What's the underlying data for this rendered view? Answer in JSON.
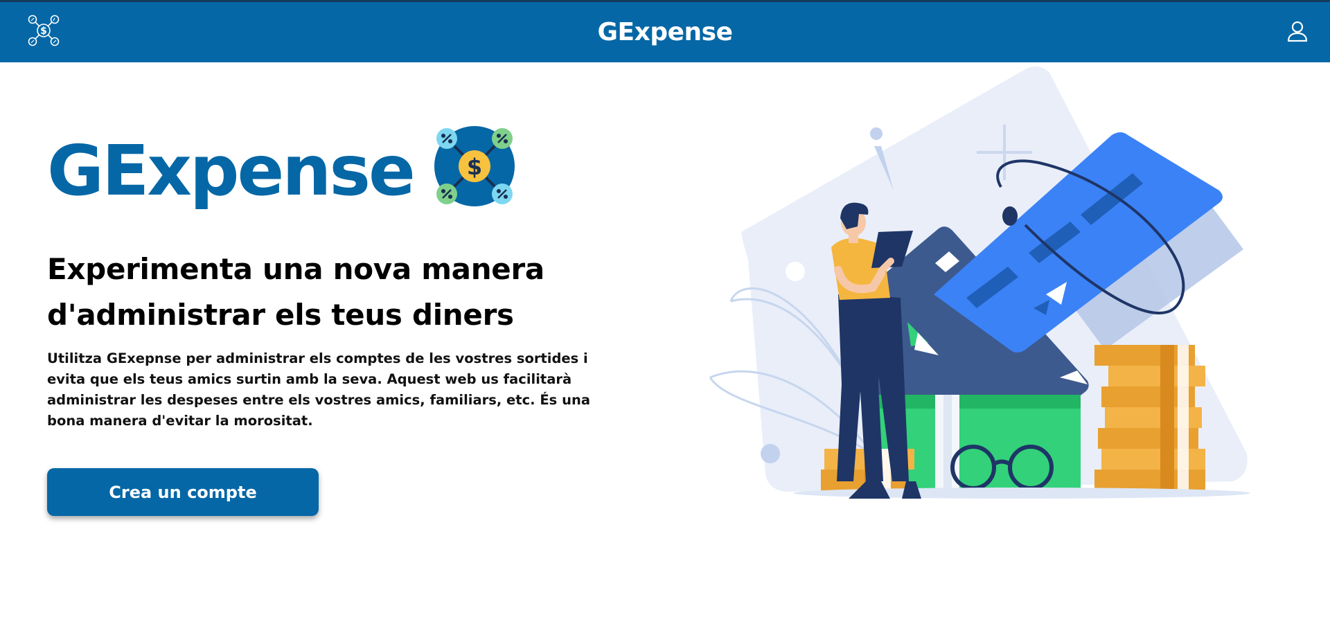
{
  "header": {
    "title": "GExpense",
    "logo_icon": "money-network-icon",
    "user_icon": "user-icon",
    "background_color": "#0567a6"
  },
  "hero": {
    "title": "GExpense",
    "title_color": "#0567a6",
    "logo_icon": "money-network-icon",
    "subtitle": "Experimenta una nova manera d'administrar els teus diners",
    "description": "Utilitza GExepnse per administrar els comptes de les vostres sortides i evita que els teus amics surtin amb la seva. Aquest web us facilitarà administrar les despeses entre els vostres amics, familiars, etc. És una bona manera d'evitar la morositat.",
    "cta_label": "Crea un compte"
  },
  "illustration": {
    "icon": "finance-illustration",
    "colors": {
      "card": "#3b82f6",
      "banknote": "#33d17a",
      "coin": "#f0a733",
      "shirt": "#f5b63f",
      "pants": "#1e3566",
      "background_shape": "#e8eef9"
    }
  }
}
